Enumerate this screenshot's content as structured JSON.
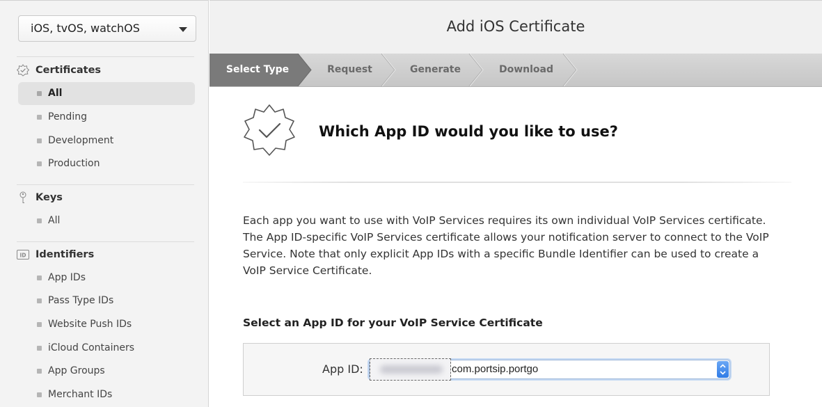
{
  "sidebar": {
    "platform": "iOS, tvOS, watchOS",
    "sections": [
      {
        "title": "Certificates",
        "icon": "certificate-badge-icon",
        "items": [
          "All",
          "Pending",
          "Development",
          "Production"
        ],
        "active": "All"
      },
      {
        "title": "Keys",
        "icon": "key-icon",
        "items": [
          "All"
        ]
      },
      {
        "title": "Identifiers",
        "icon": "id-icon",
        "items": [
          "App IDs",
          "Pass Type IDs",
          "Website Push IDs",
          "iCloud Containers",
          "App Groups",
          "Merchant IDs"
        ]
      }
    ]
  },
  "header": {
    "title": "Add iOS Certificate"
  },
  "steps": [
    "Select Type",
    "Request",
    "Generate",
    "Download"
  ],
  "content": {
    "question": "Which App ID would you like to use?",
    "description": "Each app you want to use with VoIP Services requires its own individual VoIP Services certificate. The App ID-specific VoIP Services certificate allows your notification server to connect to the VoIP Service. Note that only explicit App IDs with a specific Bundle Identifier can be used to create a VoIP Service Certificate.",
    "select_title": "Select an App ID for your VoIP Service Certificate",
    "app_id_label": "App ID:",
    "app_id_value": "com.portsip.portgo"
  },
  "colors": {
    "active_step": "#7a7a7a",
    "select_focus": "#2f7be6"
  }
}
